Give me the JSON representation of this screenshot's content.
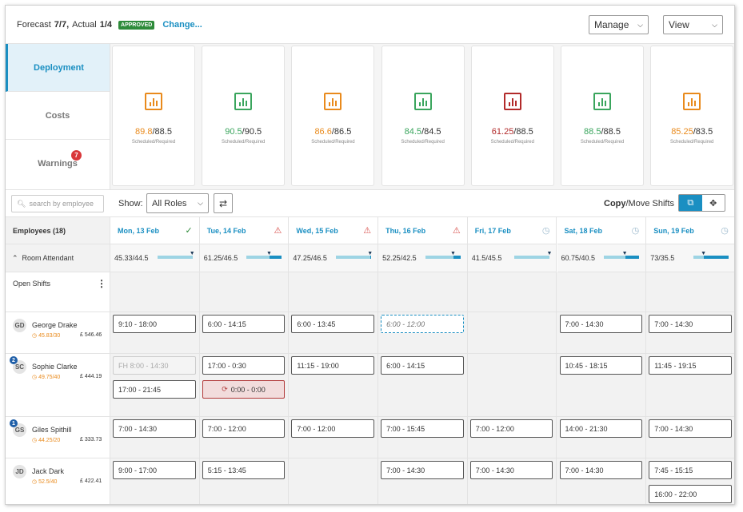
{
  "header": {
    "forecast_label": "Forecast",
    "forecast_value": "7/7,",
    "actual_label": "Actual",
    "actual_value": "1/4",
    "status_badge": "APPROVED",
    "change_link": "Change...",
    "manage_label": "Manage",
    "view_label": "View"
  },
  "sidenav": {
    "items": [
      {
        "label": "Deployment"
      },
      {
        "label": "Costs"
      },
      {
        "label": "Warnings",
        "badge": "7"
      }
    ]
  },
  "cards": [
    {
      "scheduled": "89.8",
      "required": "/88.5",
      "label": "Scheduled/Required",
      "color": "#e98a1c"
    },
    {
      "scheduled": "90.5",
      "required": "/90.5",
      "label": "Scheduled/Required",
      "color": "#3aa55d"
    },
    {
      "scheduled": "86.6",
      "required": "/86.5",
      "label": "Scheduled/Required",
      "color": "#e98a1c"
    },
    {
      "scheduled": "84.5",
      "required": "/84.5",
      "label": "Scheduled/Required",
      "color": "#3aa55d"
    },
    {
      "scheduled": "61.25",
      "required": "/88.5",
      "label": "Scheduled/Required",
      "color": "#b22a2a"
    },
    {
      "scheduled": "88.5",
      "required": "/88.5",
      "label": "Scheduled/Required",
      "color": "#3aa55d"
    },
    {
      "scheduled": "85.25",
      "required": "/83.5",
      "label": "Scheduled/Required",
      "color": "#e98a1c"
    }
  ],
  "filters": {
    "search_placeholder": "search by employee",
    "show_label": "Show:",
    "role_value": "All Roles",
    "copy_label": "Copy",
    "move_label": "/Move Shifts"
  },
  "grid": {
    "employees_header": "Employees (18)",
    "role_group": "Room Attendant",
    "open_shifts": "Open Shifts",
    "days": [
      {
        "label": "Mon, 13 Feb",
        "status": "✓",
        "status_color": "#2e8b3a",
        "ratio": "45.33/44.5",
        "fill": 0
      },
      {
        "label": "Tue, 14 Feb",
        "status": "⚠",
        "status_color": "#d9534f",
        "ratio": "61.25/46.5",
        "fill": 0.35
      },
      {
        "label": "Wed, 15 Feb",
        "status": "⚠",
        "status_color": "#d9534f",
        "ratio": "47.25/46.5",
        "fill": 0.02
      },
      {
        "label": "Thu, 16 Feb",
        "status": "⚠",
        "status_color": "#d9534f",
        "ratio": "52.25/42.5",
        "fill": 0.2
      },
      {
        "label": "Fri, 17 Feb",
        "status": "◷",
        "status_color": "#9ab8cc",
        "ratio": "41.5/45.5",
        "fill": 0
      },
      {
        "label": "Sat, 18 Feb",
        "status": "◷",
        "status_color": "#9ab8cc",
        "ratio": "60.75/40.5",
        "fill": 0.4
      },
      {
        "label": "Sun, 19 Feb",
        "status": "◷",
        "status_color": "#9ab8cc",
        "ratio": "73/35.5",
        "fill": 0.7
      }
    ],
    "employees": [
      {
        "initials": "GD",
        "name": "George Drake",
        "hours": "45.83/30",
        "cost": "£ 546.46",
        "badge": "",
        "shifts": [
          [
            "9:10 - 18:00"
          ],
          [
            "6:00 - 14:15"
          ],
          [
            "6:00 - 13:45"
          ],
          [
            "6:00 - 12:00"
          ],
          [],
          [
            "7:00 - 14:30"
          ],
          [
            "7:00 - 14:30"
          ]
        ]
      },
      {
        "initials": "SC",
        "name": "Sophie Clarke",
        "hours": "49.75/40",
        "cost": "£ 444.19",
        "badge": "2",
        "shifts": [
          [
            "FH 8:00 - 14:30",
            "17:00 - 21:45"
          ],
          [
            "17:00 - 0:30",
            "0:00 - 0:00"
          ],
          [
            "11:15 - 19:00"
          ],
          [
            "6:00 - 14:15"
          ],
          [],
          [
            "10:45 - 18:15"
          ],
          [
            "11:45 - 19:15"
          ]
        ]
      },
      {
        "initials": "GS",
        "name": "Giles Spithill",
        "hours": "44.25/20",
        "cost": "£ 333.73",
        "badge": "1",
        "shifts": [
          [
            "7:00 - 14:30"
          ],
          [
            "7:00 - 12:00"
          ],
          [
            "7:00 - 12:00"
          ],
          [
            "7:00 - 15:45"
          ],
          [
            "7:00 - 12:00"
          ],
          [
            "14:00 - 21:30"
          ],
          [
            "7:00 - 14:30"
          ]
        ]
      },
      {
        "initials": "JD",
        "name": "Jack Dark",
        "hours": "52.5/40",
        "cost": "£ 422.41",
        "badge": "",
        "shifts": [
          [
            "9:00 - 17:00"
          ],
          [
            "5:15 - 13:45"
          ],
          [],
          [
            "7:00 - 14:30"
          ],
          [
            "7:00 - 14:30"
          ],
          [
            "7:00 - 14:30"
          ],
          [
            "7:45 - 15:15",
            "16:00 - 22:00"
          ]
        ]
      }
    ]
  }
}
